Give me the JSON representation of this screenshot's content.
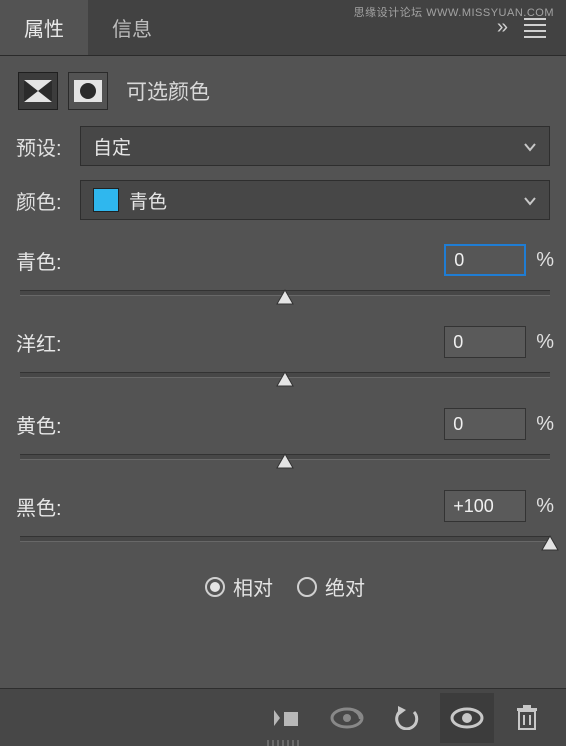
{
  "watermark": "思缘设计论坛  WWW.MISSYUAN.COM",
  "tabs": {
    "active": "属性",
    "inactive": "信息"
  },
  "panel": {
    "title": "可选颜色"
  },
  "preset": {
    "label": "预设:",
    "value": "自定"
  },
  "color": {
    "label": "颜色:",
    "value": "青色",
    "swatch": "#2fb7ee"
  },
  "sliders": {
    "cyan": {
      "label": "青色:",
      "value": "0",
      "pos": 50
    },
    "magenta": {
      "label": "洋红:",
      "value": "0",
      "pos": 50
    },
    "yellow": {
      "label": "黄色:",
      "value": "0",
      "pos": 50
    },
    "black": {
      "label": "黑色:",
      "value": "+100",
      "pos": 100
    }
  },
  "unit": "%",
  "method": {
    "relative": "相对",
    "absolute": "绝对",
    "selected": "relative"
  },
  "icons": {
    "clip": "clip-adjustment-icon",
    "view": "view-previous-icon",
    "reset": "reset-icon",
    "visibility": "visibility-icon",
    "delete": "trash-icon"
  }
}
